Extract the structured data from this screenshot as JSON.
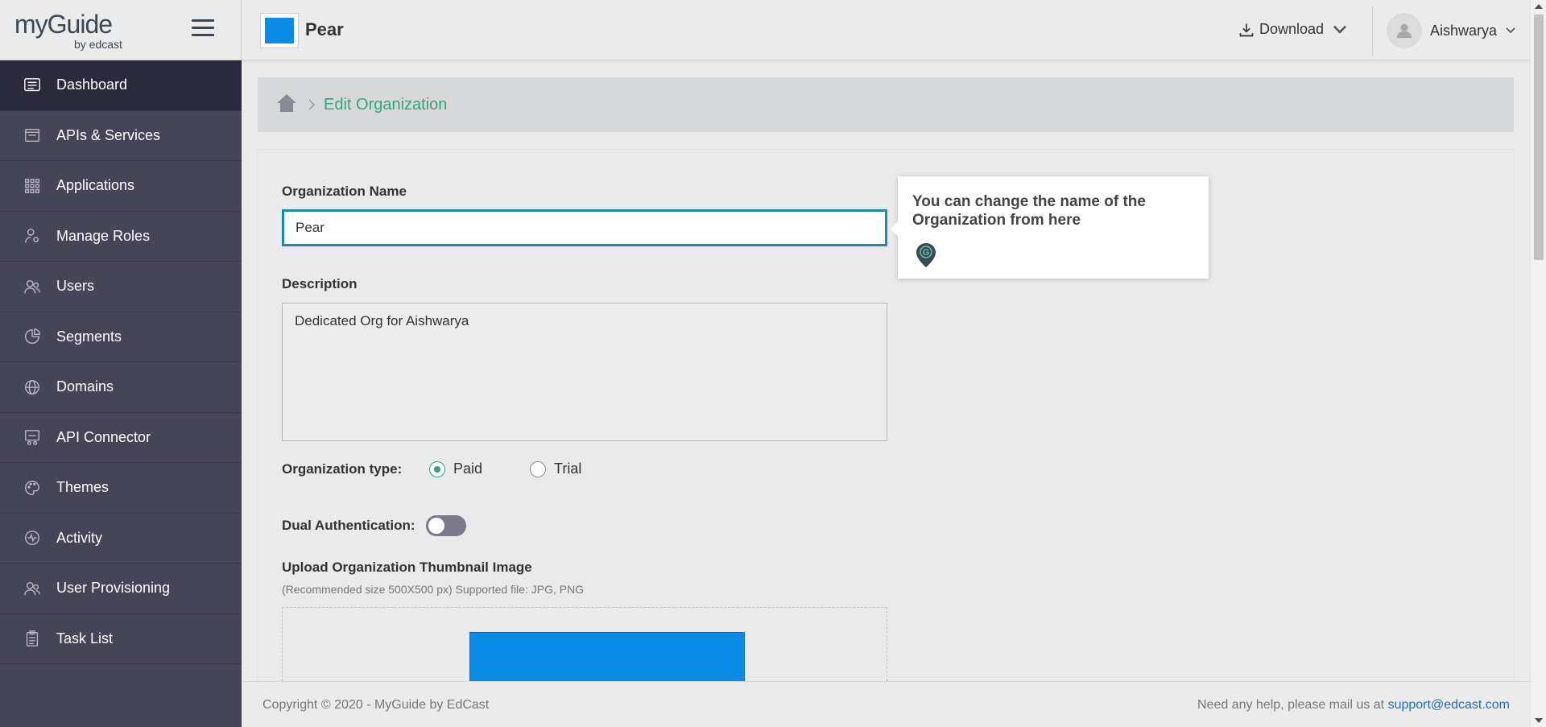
{
  "brand": {
    "logo_main": "myGuide",
    "logo_by": "by edcast"
  },
  "sidebar": {
    "items": [
      {
        "label": "Dashboard",
        "icon": "dashboard-icon"
      },
      {
        "label": "APIs & Services",
        "icon": "api-icon"
      },
      {
        "label": "Applications",
        "icon": "grid-icon"
      },
      {
        "label": "Manage Roles",
        "icon": "user-gear-icon"
      },
      {
        "label": "Users",
        "icon": "users-icon"
      },
      {
        "label": "Segments",
        "icon": "pie-icon"
      },
      {
        "label": "Domains",
        "icon": "globe-icon"
      },
      {
        "label": "API Connector",
        "icon": "api-connector-icon"
      },
      {
        "label": "Themes",
        "icon": "palette-icon"
      },
      {
        "label": "Activity",
        "icon": "activity-icon"
      },
      {
        "label": "User Provisioning",
        "icon": "users-icon"
      },
      {
        "label": "Task List",
        "icon": "clipboard-icon"
      }
    ],
    "active_index": 0
  },
  "topbar": {
    "org_name": "Pear",
    "download_label": "Download",
    "user_name": "Aishwarya"
  },
  "breadcrumb": {
    "current": "Edit Organization"
  },
  "form": {
    "org_name_label": "Organization Name",
    "org_name_value": "Pear",
    "description_label": "Description",
    "description_value": "Dedicated Org for Aishwarya",
    "org_type_label": "Organization type:",
    "org_type_options": [
      "Paid",
      "Trial"
    ],
    "org_type_selected": "Paid",
    "dual_auth_label": "Dual Authentication:",
    "dual_auth_enabled": false,
    "upload_label": "Upload Organization Thumbnail Image",
    "upload_hint": "(Recommended size 500X500 px) Supported file: JPG, PNG"
  },
  "tooltip": {
    "text": "You can change the name of the Organization from here"
  },
  "footer": {
    "copyright": "Copyright © 2020 - MyGuide by EdCast",
    "help_text": "Need any help, please mail us at ",
    "help_email": "support@edcast.com"
  },
  "colors": {
    "sidebar_bg": "#464457",
    "sidebar_active": "#2a2a3c",
    "accent_green": "#3aa37a",
    "input_focus": "#1e88b4",
    "org_thumb": "#0a8ce6",
    "link": "#1f6fbf"
  }
}
